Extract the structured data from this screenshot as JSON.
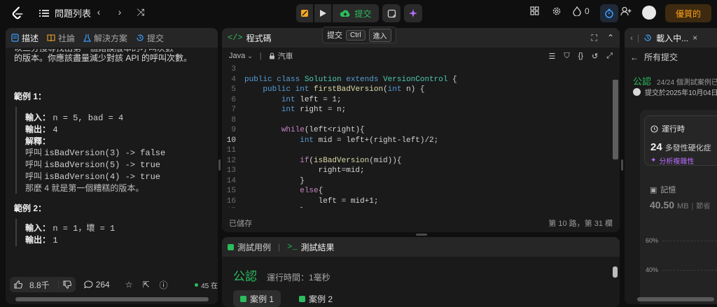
{
  "topbar": {
    "problem_list": "問題列表",
    "submit_label": "提交",
    "tooltip": {
      "label": "提交",
      "key1": "Ctrl",
      "key2": "進入"
    },
    "streak_count": "0",
    "premium_label": "優質的"
  },
  "left_panel": {
    "tabs": [
      "描述",
      "社論",
      "解決方案",
      "提交"
    ],
    "intro_cut": "以二分搜尋找出第一個錯誤版本的呼叫次數",
    "intro": "的版本。你應該盡量減少對該 API 的呼叫次數。",
    "example1": {
      "title": "範例 1：",
      "input_label": "輸入：",
      "input": "n = 5, bad = 4",
      "output_label": "輸出：",
      "output": "4",
      "explain_label": "解釋：",
      "calls": [
        {
          "prefix": "呼叫",
          "code": "isBadVersion(3) -> false"
        },
        {
          "prefix": "呼叫",
          "code": "isBadVersion(5) -> true"
        },
        {
          "prefix": "呼叫",
          "code": "isBadVersion(4) -> true"
        }
      ],
      "conclusion": "那麼 4 就是第一個糟糕的版本。"
    },
    "example2": {
      "title": "範例 2：",
      "input_label": "輸入：",
      "input": "n = 1，壞 = 1",
      "output_label": "輸出：",
      "output": "1"
    },
    "footer": {
      "likes": "8.8千",
      "comments": "264",
      "online": "45 在"
    }
  },
  "code_panel": {
    "title": "程式碼",
    "language": "Java",
    "mode": "汽車",
    "saved": "已儲存",
    "cursor": "第 10 路，第 31 欄",
    "lines": [
      {
        "n": "3",
        "indent": "",
        "tokens": []
      },
      {
        "n": "4",
        "indent": "",
        "tokens": [
          [
            "kt",
            "public "
          ],
          [
            "kt",
            "class "
          ],
          [
            "cls",
            "Solution "
          ],
          [
            "kt",
            "extends "
          ],
          [
            "cls",
            "VersionControl "
          ],
          [
            "tx",
            "{"
          ]
        ]
      },
      {
        "n": "5",
        "indent": "    ",
        "tokens": [
          [
            "kt",
            "public "
          ],
          [
            "kt",
            "int "
          ],
          [
            "fn",
            "firstBadVersion"
          ],
          [
            "tx",
            "("
          ],
          [
            "kt",
            "int "
          ],
          [
            "tx",
            "n) {"
          ]
        ]
      },
      {
        "n": "6",
        "indent": "        ",
        "tokens": [
          [
            "kt",
            "int "
          ],
          [
            "tx",
            "left = 1;"
          ]
        ]
      },
      {
        "n": "7",
        "indent": "        ",
        "tokens": [
          [
            "kt",
            "int "
          ],
          [
            "tx",
            "right = n;"
          ]
        ]
      },
      {
        "n": "8",
        "indent": "",
        "tokens": []
      },
      {
        "n": "9",
        "indent": "        ",
        "tokens": [
          [
            "kw",
            "while"
          ],
          [
            "tx",
            "(left<right){"
          ]
        ]
      },
      {
        "n": "10",
        "indent": "            ",
        "tokens": [
          [
            "kt",
            "int "
          ],
          [
            "tx",
            "mid = left+(right-left)/2;"
          ]
        ]
      },
      {
        "n": "11",
        "indent": "",
        "tokens": []
      },
      {
        "n": "12",
        "indent": "            ",
        "tokens": [
          [
            "kw",
            "if"
          ],
          [
            "tx",
            "("
          ],
          [
            "fn",
            "isBadVersion"
          ],
          [
            "tx",
            "(mid)){"
          ]
        ]
      },
      {
        "n": "13",
        "indent": "                ",
        "tokens": [
          [
            "tx",
            "right=mid;"
          ]
        ]
      },
      {
        "n": "14",
        "indent": "            ",
        "tokens": [
          [
            "tx",
            "}"
          ]
        ]
      },
      {
        "n": "15",
        "indent": "            ",
        "tokens": [
          [
            "kw",
            "else"
          ],
          [
            "tx",
            "{"
          ]
        ]
      },
      {
        "n": "16",
        "indent": "                ",
        "tokens": [
          [
            "tx",
            "left = mid+1;"
          ]
        ]
      },
      {
        "n": "17",
        "indent": "            ",
        "tokens": [
          [
            "tx",
            "}"
          ]
        ]
      }
    ]
  },
  "test_panel": {
    "tab_cases": "測試用例",
    "tab_results": "測試結果",
    "status": "公認",
    "runtime": "運行時間：1毫秒",
    "case1": "案例 1",
    "case2": "案例 2"
  },
  "right_panel": {
    "tab": "載入中...",
    "back_label": "所有提交",
    "status": "公認",
    "cases": "24/24 個測試案例已通過",
    "submitted": "提交於2025年10月04日",
    "runtime_title": "運行時",
    "runtime_value": "24",
    "runtime_unit": "多發性硬化症",
    "analyze": "分析複雜性",
    "memory_title": "記憶",
    "memory_value": "40.50",
    "memory_unit": "MB",
    "memory_extra": "節省",
    "pct_60": "60%",
    "pct_40": "40%"
  }
}
